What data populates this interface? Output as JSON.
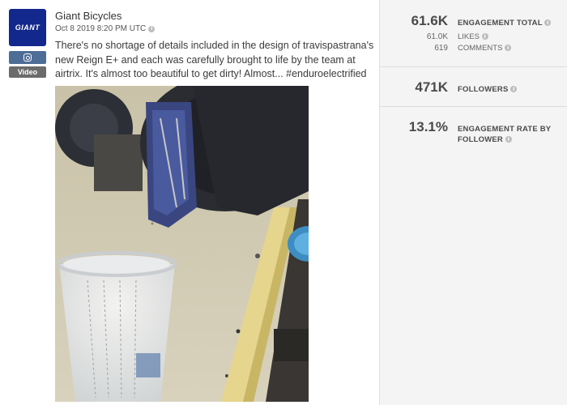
{
  "post": {
    "account_name": "Giant Bicycles",
    "logo_text": "GIANT",
    "timestamp": "Oct 8 2019 8:20 PM UTC",
    "platform_icon": "instagram-icon",
    "media_type": "Video",
    "caption": "There's no shortage of details included in the design of travispastrana's new Reign E+ and each was carefully brought to life by the team at airtrix. It's almost too beautiful to get dirty! Almost... #enduroelectrified"
  },
  "metrics": {
    "engagement_total": {
      "value": "61.6K",
      "label": "ENGAGEMENT TOTAL"
    },
    "likes": {
      "value": "61.0K",
      "label": "LIKES"
    },
    "comments": {
      "value": "619",
      "label": "COMMENTS"
    },
    "followers": {
      "value": "471K",
      "label": "FOLLOWERS"
    },
    "engagement_rate": {
      "value": "13.1%",
      "label_line1": "ENGAGEMENT RATE BY",
      "label_line2": "FOLLOWER"
    }
  },
  "colors": {
    "brand": "#13288c",
    "instagram_badge": "#4e6d96",
    "video_badge": "#6b6b6b",
    "metrics_panel": "#f4f4f4"
  }
}
